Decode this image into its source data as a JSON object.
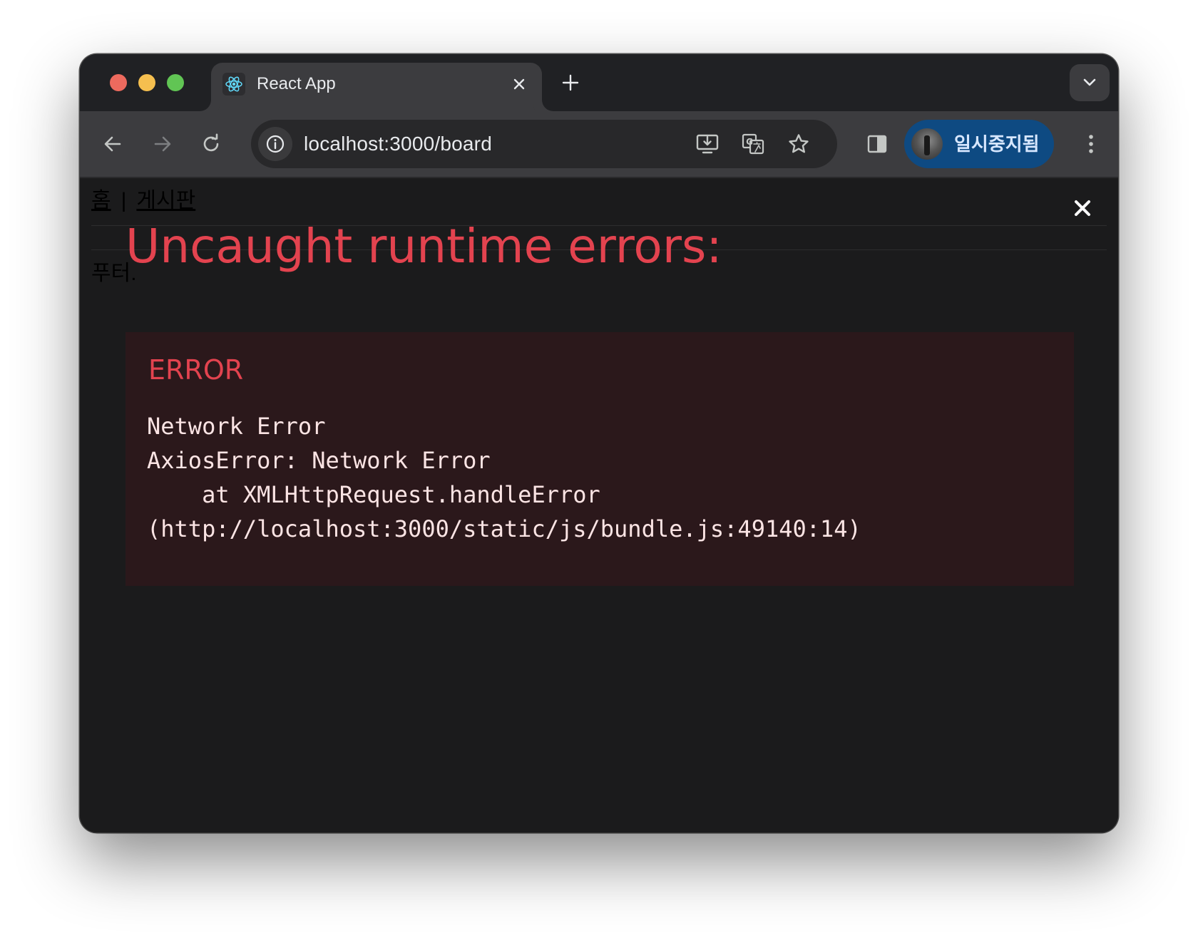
{
  "browser": {
    "tab": {
      "title": "React App",
      "favicon": "react-logo-icon"
    },
    "omnibox": {
      "url": "localhost:3000/board"
    },
    "profile": {
      "label": "일시중지됨"
    },
    "icons": {
      "back": "arrow-left-icon",
      "forward": "arrow-right-icon",
      "reload": "reload-icon",
      "site_info": "info-icon",
      "install": "install-app-icon",
      "translate": "translate-icon",
      "bookmark": "star-icon",
      "side_panel": "side-panel-icon",
      "menu": "kebab-menu-icon",
      "new_tab": "plus-icon",
      "tab_search": "chevron-down-icon"
    }
  },
  "page": {
    "nav": {
      "home": "홈",
      "separator": "|",
      "board": "게시판"
    },
    "footer": "푸터."
  },
  "overlay": {
    "title": "Uncaught runtime errors:",
    "error_label": "ERROR",
    "message": "Network Error\nAxiosError: Network Error\n    at XMLHttpRequest.handleError\n(http://localhost:3000/static/js/bundle.js:49140:14)"
  },
  "colors": {
    "error_red": "#e3434f",
    "error_box_bg": "#2b181b",
    "page_bg": "#1b1b1c",
    "profile_bg": "#0e4a82"
  }
}
